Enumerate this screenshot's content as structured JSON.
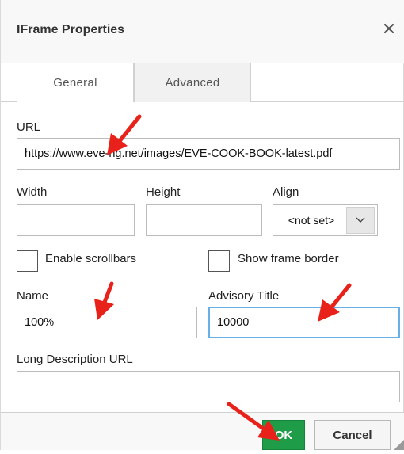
{
  "dialog": {
    "title": "IFrame Properties",
    "close_icon": "close-icon"
  },
  "tabs": [
    {
      "label": "General",
      "active": true
    },
    {
      "label": "Advanced",
      "active": false
    }
  ],
  "form": {
    "url_label": "URL",
    "url_value": "https://www.eve-ng.net/images/EVE-COOK-BOOK-latest.pdf",
    "width_label": "Width",
    "width_value": "",
    "height_label": "Height",
    "height_value": "",
    "align_label": "Align",
    "align_value": "<not set>",
    "scrollbars_label": "Enable scrollbars",
    "scrollbars_checked": false,
    "border_label": "Show frame border",
    "border_checked": false,
    "name_label": "Name",
    "name_value": "100%",
    "advisory_label": "Advisory Title",
    "advisory_value": "10000",
    "longdesc_label": "Long Description URL",
    "longdesc_value": ""
  },
  "footer": {
    "ok_label": "OK",
    "cancel_label": "Cancel"
  },
  "colors": {
    "ok_button": "#1e9c47",
    "focus_border": "#66afe9",
    "annotation_arrow": "#e8221b"
  }
}
